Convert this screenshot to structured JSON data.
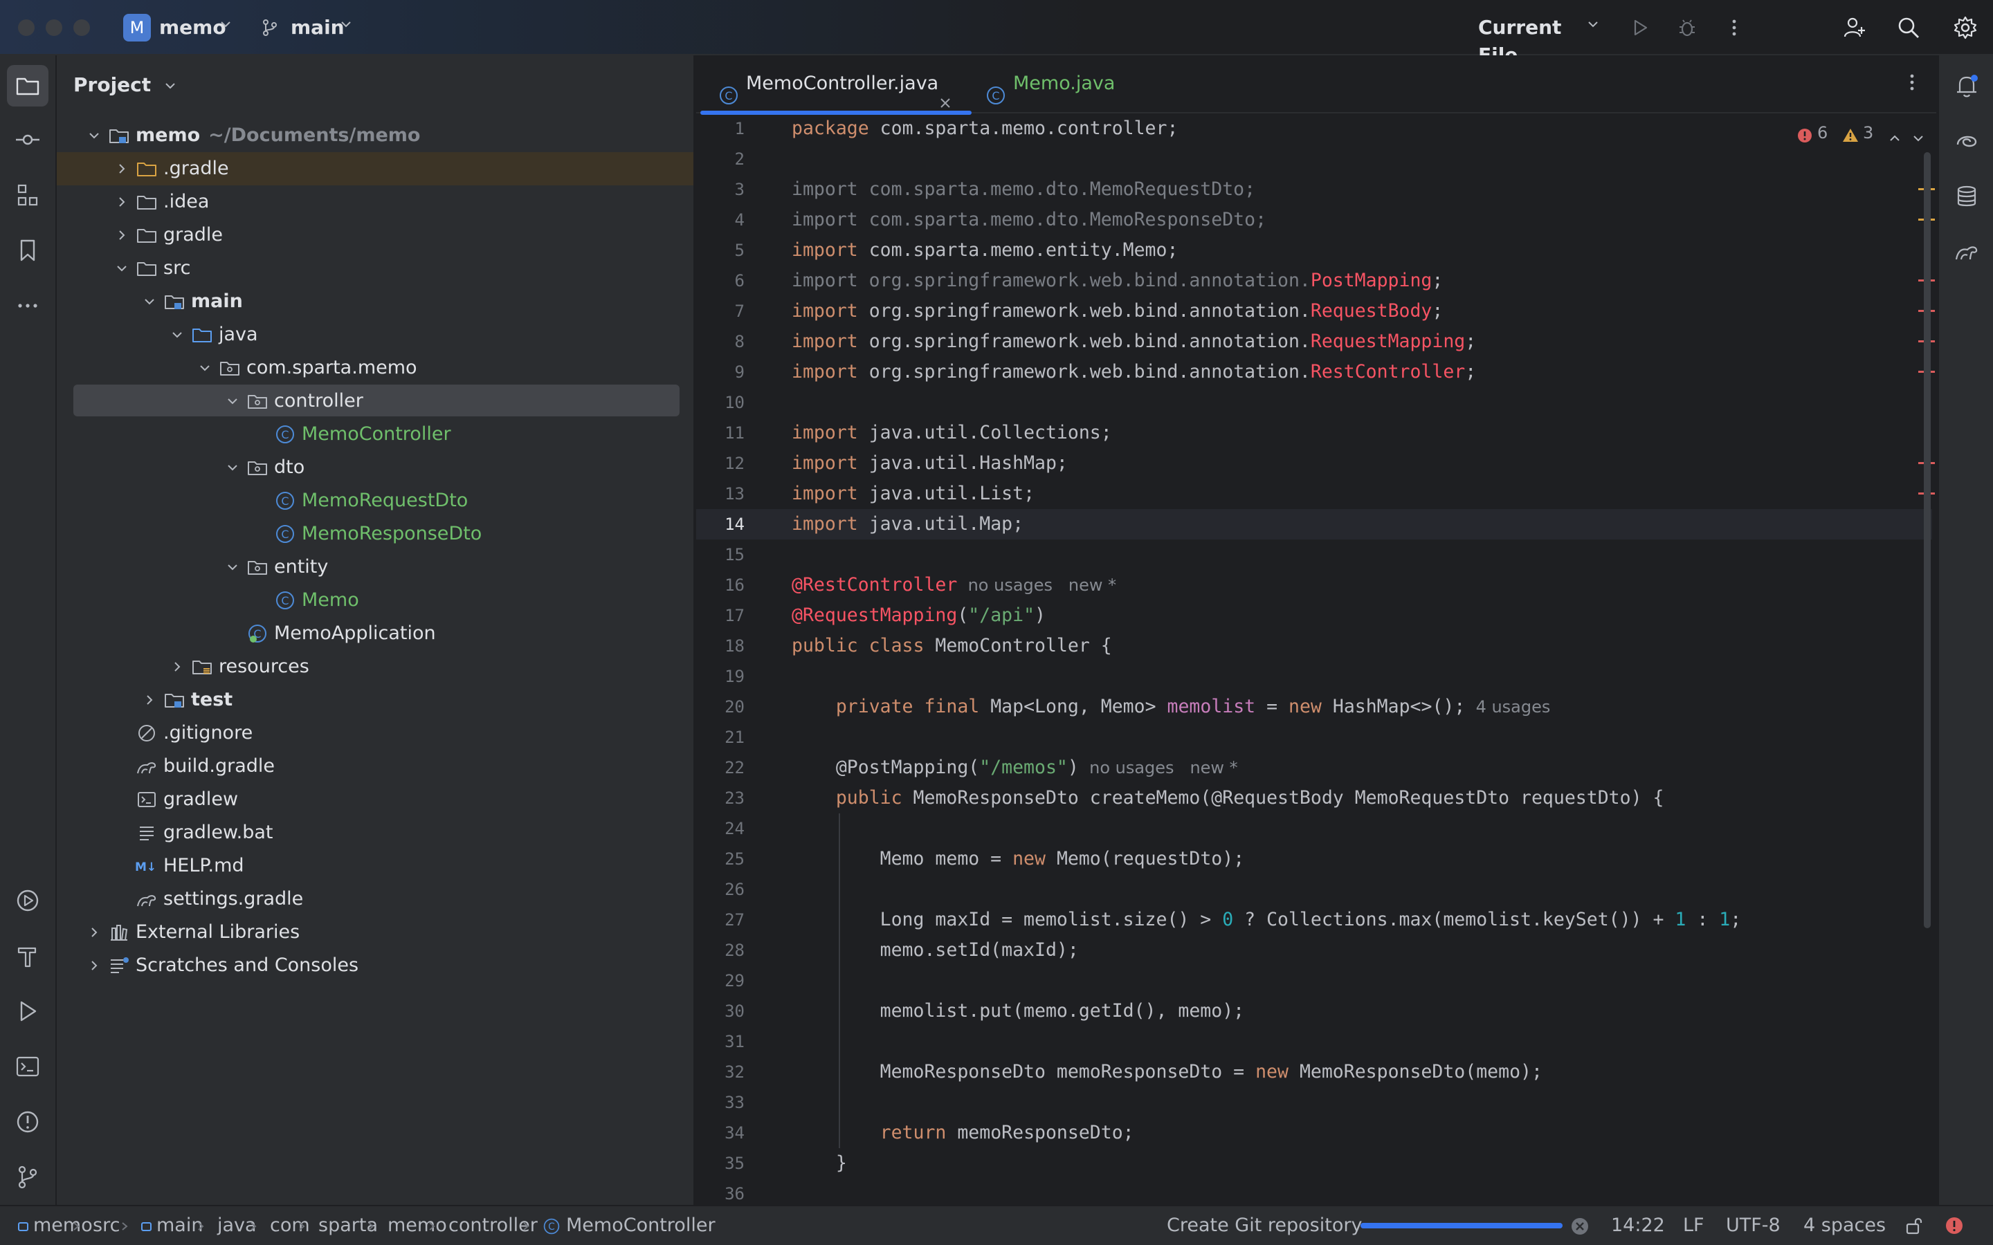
{
  "titlebar": {
    "project_initial": "M",
    "project_name": "memo",
    "branch": "main",
    "run_config": "Current File"
  },
  "project_panel": {
    "title": "Project",
    "tree": [
      {
        "label": "memo",
        "suffix": "~/Documents/memo",
        "depth": 0,
        "expanded": true,
        "icon": "module-folder-icon",
        "bold": true
      },
      {
        "label": ".gradle",
        "depth": 1,
        "expanded": false,
        "icon": "folder-orange-icon",
        "highlight": true
      },
      {
        "label": ".idea",
        "depth": 1,
        "expanded": false,
        "icon": "folder-icon"
      },
      {
        "label": "gradle",
        "depth": 1,
        "expanded": false,
        "icon": "folder-icon"
      },
      {
        "label": "src",
        "depth": 1,
        "expanded": true,
        "icon": "folder-icon"
      },
      {
        "label": "main",
        "depth": 2,
        "expanded": true,
        "icon": "module-folder-icon",
        "bold": true
      },
      {
        "label": "java",
        "depth": 3,
        "expanded": true,
        "icon": "source-folder-icon"
      },
      {
        "label": "com.sparta.memo",
        "depth": 4,
        "expanded": true,
        "icon": "package-icon"
      },
      {
        "label": "controller",
        "depth": 5,
        "expanded": true,
        "icon": "package-icon",
        "selected": true
      },
      {
        "label": "MemoController",
        "depth": 6,
        "icon": "class-icon",
        "green": true
      },
      {
        "label": "dto",
        "depth": 5,
        "expanded": true,
        "icon": "package-icon"
      },
      {
        "label": "MemoRequestDto",
        "depth": 6,
        "icon": "class-icon",
        "green": true
      },
      {
        "label": "MemoResponseDto",
        "depth": 6,
        "icon": "class-icon",
        "green": true
      },
      {
        "label": "entity",
        "depth": 5,
        "expanded": true,
        "icon": "package-icon"
      },
      {
        "label": "Memo",
        "depth": 6,
        "icon": "class-icon",
        "green": true
      },
      {
        "label": "MemoApplication",
        "depth": 5,
        "icon": "spring-boot-class-icon"
      },
      {
        "label": "resources",
        "depth": 3,
        "expanded": false,
        "icon": "resources-folder-icon"
      },
      {
        "label": "test",
        "depth": 2,
        "expanded": false,
        "icon": "module-folder-icon",
        "bold": true
      },
      {
        "label": ".gitignore",
        "depth": 1,
        "icon": "ignore-file-icon"
      },
      {
        "label": "build.gradle",
        "depth": 1,
        "icon": "gradle-file-icon"
      },
      {
        "label": "gradlew",
        "depth": 1,
        "icon": "shell-file-icon"
      },
      {
        "label": "gradlew.bat",
        "depth": 1,
        "icon": "text-file-icon"
      },
      {
        "label": "HELP.md",
        "depth": 1,
        "icon": "markdown-file-icon"
      },
      {
        "label": "settings.gradle",
        "depth": 1,
        "icon": "gradle-file-icon"
      },
      {
        "label": "External Libraries",
        "depth": 0,
        "expanded": false,
        "icon": "libraries-icon"
      },
      {
        "label": "Scratches and Consoles",
        "depth": 0,
        "expanded": false,
        "icon": "scratches-icon"
      }
    ]
  },
  "editor": {
    "tabs": [
      {
        "label": "MemoController.java",
        "active": true,
        "closable": true
      },
      {
        "label": "Memo.java",
        "active": false
      }
    ],
    "inspections": {
      "errors": "6",
      "warnings": "3"
    },
    "current_line": 14,
    "lines": [
      [
        [
          "kw",
          "package"
        ],
        [
          "",
          "com.sparta.memo.controller;"
        ]
      ],
      [],
      [
        [
          "dim",
          "import com.sparta.memo.dto.MemoRequestDto;"
        ]
      ],
      [
        [
          "dim",
          "import com.sparta.memo.dto.MemoResponseDto;"
        ]
      ],
      [
        [
          "kw",
          "import"
        ],
        [
          "",
          "com.sparta.memo.entity.Memo;"
        ]
      ],
      [
        [
          "dim",
          "import org.springframework.web.bind.annotation."
        ],
        [
          "err",
          "PostMapping"
        ],
        [
          "",
          ";"
        ]
      ],
      [
        [
          "kw",
          "import"
        ],
        [
          "",
          "org.springframework.web.bind.annotation."
        ],
        [
          "err",
          "RequestBody"
        ],
        [
          "",
          ";"
        ]
      ],
      [
        [
          "kw",
          "import"
        ],
        [
          "",
          "org.springframework.web.bind.annotation."
        ],
        [
          "err",
          "RequestMapping"
        ],
        [
          "",
          ";"
        ]
      ],
      [
        [
          "kw",
          "import"
        ],
        [
          "",
          "org.springframework.web.bind.annotation."
        ],
        [
          "err",
          "RestController"
        ],
        [
          "",
          ";"
        ]
      ],
      [],
      [
        [
          "kw",
          "import"
        ],
        [
          "",
          "java.util.Collections;"
        ]
      ],
      [
        [
          "kw",
          "import"
        ],
        [
          "",
          "java.util.HashMap;"
        ]
      ],
      [
        [
          "kw",
          "import"
        ],
        [
          "",
          "java.util.List;"
        ]
      ],
      [
        [
          "kw",
          "import"
        ],
        [
          "",
          "java.util.Map;"
        ]
      ],
      [],
      [
        [
          "ann",
          "@RestController"
        ],
        [
          "hint",
          "  no usages   new *"
        ]
      ],
      [
        [
          "ann",
          "@RequestMapping"
        ],
        [
          "",
          "("
        ],
        [
          "str",
          "\"/api\""
        ],
        [
          "",
          ")"
        ]
      ],
      [
        [
          "kw",
          "public class"
        ],
        [
          "",
          "MemoController {"
        ]
      ],
      [],
      [
        [
          "",
          "    "
        ],
        [
          "kw",
          "private final"
        ],
        [
          "",
          "Map<Long, Memo> "
        ],
        [
          "fld",
          "memolist"
        ],
        [
          "",
          " = "
        ],
        [
          "kw",
          "new"
        ],
        [
          "",
          "HashMap<>();"
        ],
        [
          "hint",
          "  4 usages"
        ]
      ],
      [],
      [
        [
          "",
          "    @PostMapping("
        ],
        [
          "str",
          "\"/memos\""
        ],
        [
          "",
          ")"
        ],
        [
          "hint",
          "  no usages   new *"
        ]
      ],
      [
        [
          "",
          "    "
        ],
        [
          "kw",
          "public"
        ],
        [
          "",
          "MemoResponseDto createMemo(@RequestBody MemoRequestDto requestDto) {"
        ]
      ],
      [],
      [
        [
          "",
          "        Memo memo = "
        ],
        [
          "kw",
          "new"
        ],
        [
          "",
          "Memo(requestDto);"
        ]
      ],
      [],
      [
        [
          "",
          "        Long maxId = memolist.size() > "
        ],
        [
          "num",
          "0"
        ],
        [
          "",
          " ? Collections.max(memolist.keySet()) + "
        ],
        [
          "num",
          "1"
        ],
        [
          "",
          " : "
        ],
        [
          "num",
          "1"
        ],
        [
          "",
          ";"
        ]
      ],
      [
        [
          "",
          "        memo.setId(maxId);"
        ]
      ],
      [],
      [
        [
          "",
          "        memolist.put(memo.getId(), memo);"
        ]
      ],
      [],
      [
        [
          "",
          "        MemoResponseDto memoResponseDto = "
        ],
        [
          "kw",
          "new"
        ],
        [
          "",
          "MemoResponseDto(memo);"
        ]
      ],
      [],
      [
        [
          "",
          "        "
        ],
        [
          "kw",
          "return"
        ],
        [
          "",
          "memoResponseDto;"
        ]
      ],
      [
        [
          "",
          "    }"
        ]
      ],
      []
    ]
  },
  "statusbar": {
    "breadcrumbs": [
      "memo",
      "src",
      "main",
      "java",
      "com",
      "sparta",
      "memo",
      "controller",
      "MemoController"
    ],
    "git_task": "Create Git repository",
    "git_progress": 1.0,
    "cursor": "14:22",
    "line_sep": "LF",
    "encoding": "UTF-8",
    "indent": "4 spaces"
  },
  "colors": {
    "accent": "#3574f0",
    "class_green": "#6fbf6b",
    "error": "#f75464",
    "warning": "#e0a030",
    "keyword": "#cf8e6d"
  }
}
